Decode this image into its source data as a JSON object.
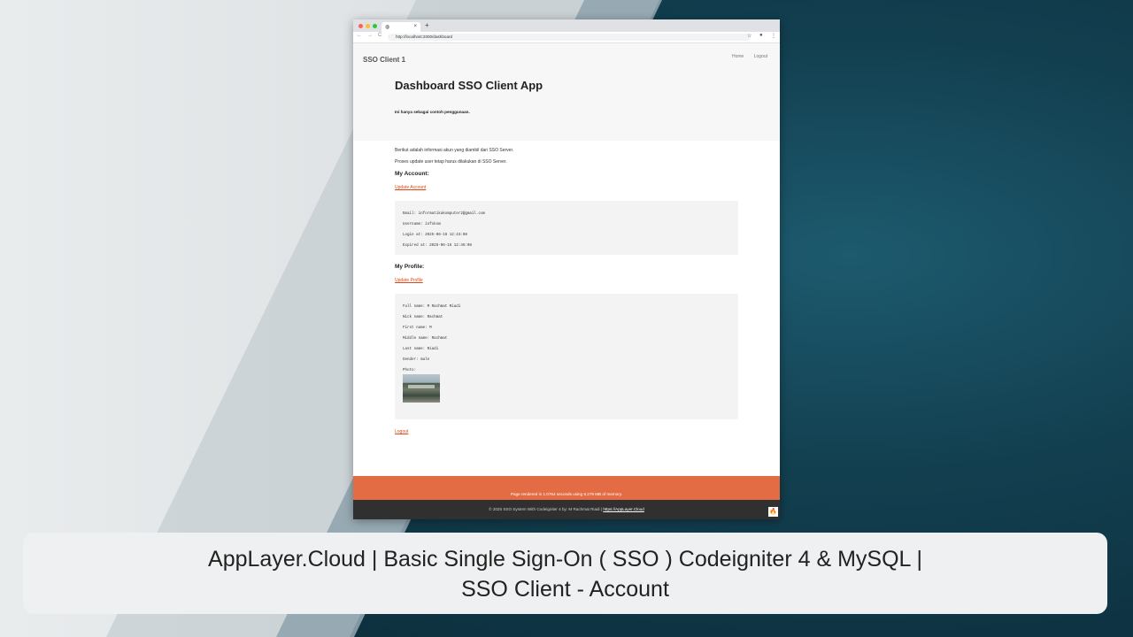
{
  "browser": {
    "tab_icon": "globe-icon",
    "tab_close": "×",
    "new_tab": "+",
    "url": "http://localhost:2000/dashboard",
    "nav": {
      "back": "←",
      "forward": "→",
      "reload": "C"
    },
    "star": "☆",
    "profile": "●",
    "more": "⋮"
  },
  "app": {
    "brand": "SSO Client 1",
    "menu": {
      "home": "Home",
      "logout": "Logout"
    },
    "title": "Dashboard SSO Client App",
    "subtitle": "Ini hanya sebagai contoh penggunaan."
  },
  "content": {
    "intro1": "Berikut adalah informasi akun yang diambil dari SSO Server.",
    "intro2": "Proses update user tetap harus dilakukan di SSO Server.",
    "account_heading": "My Account:",
    "update_account": "Update Account",
    "account": {
      "email": "Email: informatikakomputer2@gmail.com",
      "username": "Username: infokom",
      "login_at": "Login at: 2025-06-16 12:43:08",
      "expired_at": "Expired at: 2025-06-16 12:46:08"
    },
    "profile_heading": "My Profile:",
    "update_profile": "Update Profile",
    "profile": {
      "full_name": "Full name: M Rachmat Riadi",
      "nick_name": "Nick name: Rachmat",
      "first_name": "First name: M",
      "middle_name": "Middle name: Rachmat",
      "last_name": "Last name: Riadi",
      "gender": "Gender: male",
      "photo": "Photo:"
    },
    "logout": "Logout"
  },
  "footer": {
    "render": "Page rendered in 1.0764 seconds using 6.279 MB of memory.",
    "env": "Environment: development | Version: 4.6.1",
    "copyright": "© 2025 SSO System With Codeigniter 4 by: M Rachmat Riadi |",
    "link": "https://AppLayer.Cloud",
    "badge_icon": "codeigniter-flame-icon"
  },
  "caption": {
    "line1": "AppLayer.Cloud | Basic Single Sign-On ( SSO ) Codeigniter 4 & MySQL |",
    "line2": "SSO Client - Account"
  },
  "colors": {
    "accent": "#e46c45",
    "link": "#dd4814",
    "footer_dark": "#303030",
    "bg_dark": "#123f50"
  }
}
